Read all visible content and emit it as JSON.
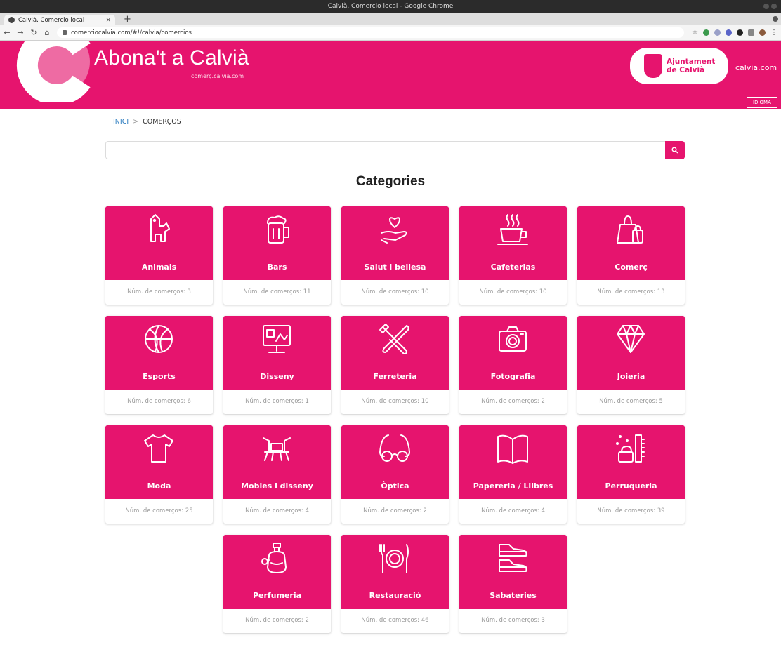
{
  "window": {
    "title": "Calvià. Comercio local - Google Chrome"
  },
  "tab": {
    "title": "Calvià. Comercio local",
    "close": "×",
    "new": "+"
  },
  "browser": {
    "url": "comerciocalvia.com/#!/calvia/comercios"
  },
  "header": {
    "title": "Abona't a Calvià",
    "subtitle": "comerç.calvia.com",
    "ajuntament": "Ajuntament\nde Calvià",
    "link": "calvia.com",
    "idioma": "IDIOMA"
  },
  "breadcrumb": {
    "home": "INICI",
    "separator": ">",
    "current": "COMERÇOS"
  },
  "search": {
    "placeholder": "",
    "value": ""
  },
  "section": {
    "title": "Categories"
  },
  "colors": {
    "brand": "#e6146e",
    "link": "#2a7bbf"
  },
  "categories": [
    {
      "name": "Animals",
      "count": "Núm. de comerços: 3",
      "icon": "dog-icon"
    },
    {
      "name": "Bars",
      "count": "Núm. de comerços: 11",
      "icon": "beer-mug-icon"
    },
    {
      "name": "Salut i bellesa",
      "count": "Núm. de comerços: 10",
      "icon": "heart-hand-icon"
    },
    {
      "name": "Cafeterias",
      "count": "Núm. de comerços: 10",
      "icon": "coffee-cup-icon"
    },
    {
      "name": "Comerç",
      "count": "Núm. de comerços: 13",
      "icon": "shopping-bags-icon"
    },
    {
      "name": "Esports",
      "count": "Núm. de comerços: 6",
      "icon": "basketball-icon"
    },
    {
      "name": "Disseny",
      "count": "Núm. de comerços: 1",
      "icon": "design-board-icon"
    },
    {
      "name": "Ferreteria",
      "count": "Núm. de comerços: 10",
      "icon": "tools-icon"
    },
    {
      "name": "Fotografia",
      "count": "Núm. de comerços: 2",
      "icon": "camera-icon"
    },
    {
      "name": "Joieria",
      "count": "Núm. de comerços: 5",
      "icon": "diamond-icon"
    },
    {
      "name": "Moda",
      "count": "Núm. de comerços: 25",
      "icon": "tshirt-icon"
    },
    {
      "name": "Mobles i disseny",
      "count": "Núm. de comerços: 4",
      "icon": "furniture-icon"
    },
    {
      "name": "Òptica",
      "count": "Núm. de comerços: 2",
      "icon": "glasses-icon"
    },
    {
      "name": "Papereria / Llibres",
      "count": "Núm. de comerços: 4",
      "icon": "book-icon"
    },
    {
      "name": "Perruqueria",
      "count": "Núm. de comerços: 39",
      "icon": "hair-comb-icon"
    },
    {
      "name": "Perfumeria",
      "count": "Núm. de comerços: 2",
      "icon": "perfume-icon"
    },
    {
      "name": "Restauració",
      "count": "Núm. de comerços: 46",
      "icon": "plate-cutlery-icon"
    },
    {
      "name": "Sabateries",
      "count": "Núm. de comerços: 3",
      "icon": "shoes-icon"
    }
  ]
}
